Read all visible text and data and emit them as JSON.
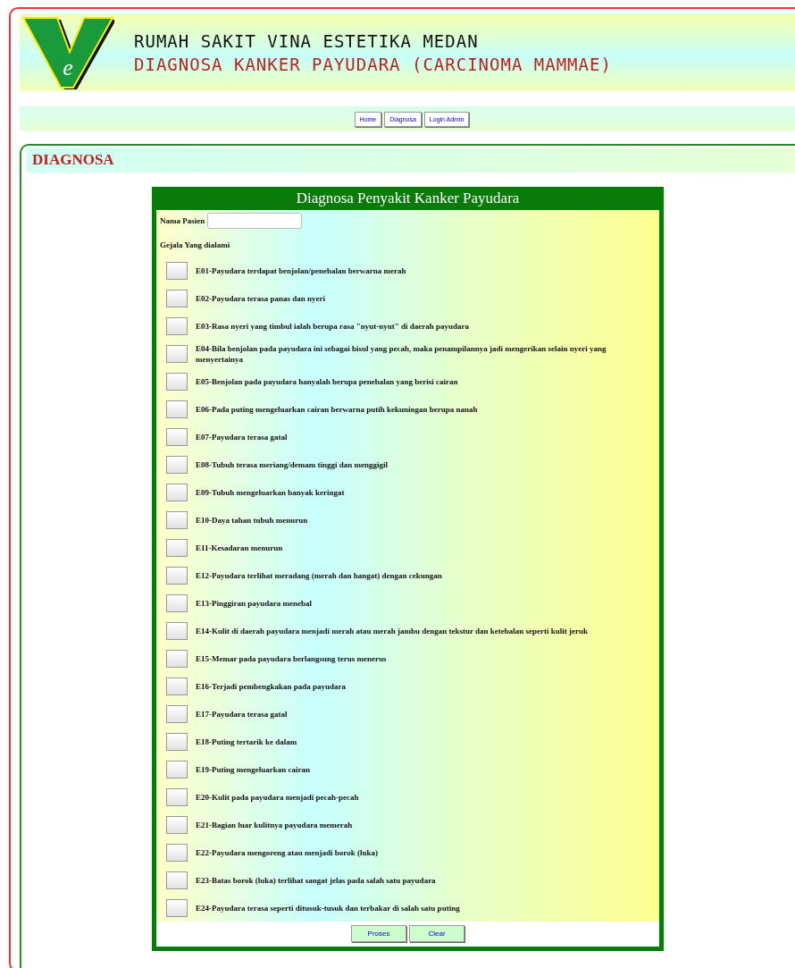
{
  "header": {
    "logo_letter": "e",
    "hospital": "RUMAH SAKIT VINA ESTETIKA MEDAN",
    "subtitle": "DIAGNOSA KANKER PAYUDARA (CARCINOMA MAMMAE)"
  },
  "nav": [
    "Home",
    "Diagnosa",
    "Login Admin"
  ],
  "section": {
    "title": "DIAGNOSA"
  },
  "form": {
    "title": "Diagnosa Penyakit Kanker Payudara",
    "patient_label": "Nama Pasien",
    "symptoms_label": "Gejala Yang dialami",
    "symptoms": [
      {
        "label": "E01-Payudara terdapat benjolan/penebalan berwarna merah",
        "checked": false
      },
      {
        "label": "E02-Payudara terasa panas dan nyeri",
        "checked": false
      },
      {
        "label": "E03-Rasa nyeri yang timbul ialah berupa rasa \"nyut-nyut\" di daerah payudara",
        "checked": false
      },
      {
        "label": "E04-Bila benjolan pada payudara ini sebagai bisul yang pecah, maka penampilannya jadi mengerikan selain nyeri yang menyertainya",
        "checked": false
      },
      {
        "label": "E05-Benjolan pada payudara hanyalah berupa penebalan yang berisi cairan",
        "checked": false
      },
      {
        "label": "E06-Pada puting mengeluarkan cairan berwarna putih kekuningan berupa nanah",
        "checked": false
      },
      {
        "label": "E07-Payudara terasa gatal",
        "checked": false
      },
      {
        "label": "E08-Tubuh terasa meriang/demam tinggi dan menggigil",
        "checked": false
      },
      {
        "label": "E09-Tubuh mengeluarkan banyak keringat",
        "checked": false
      },
      {
        "label": "E10-Daya tahan tubuh menurun",
        "checked": false
      },
      {
        "label": "E11-Kesadaran menurun",
        "checked": false
      },
      {
        "label": "E12-Payudara terlihat meradang (merah dan hangat) dengan cekungan",
        "checked": false
      },
      {
        "label": "E13-Pinggiran payudara menebal",
        "checked": false
      },
      {
        "label": "E14-Kulit di daerah payudara menjadi merah atau merah jambu dengan tekstur dan ketebalan seperti kulit jeruk",
        "checked": false
      },
      {
        "label": "E15-Memar pada payudara berlangsung terus menerus",
        "checked": false
      },
      {
        "label": "E16-Terjadi pembengkakan pada payudara",
        "checked": false
      },
      {
        "label": "E17-Payudara terasa gatal",
        "checked": false
      },
      {
        "label": "E18-Puting tertarik ke dalam",
        "checked": false
      },
      {
        "label": "E19-Puting mengeluarkan cairan",
        "checked": false
      },
      {
        "label": "E20-Kulit pada payudara menjadi pecah-pecah",
        "checked": false
      },
      {
        "label": "E21-Bagian luar kulitnya payudara memerah",
        "checked": false
      },
      {
        "label": "E22-Payudara mengoreng atau menjadi borok (luka)",
        "checked": false
      },
      {
        "label": "E23-Batas borok (luka) terlihat sangat jelas pada salah satu payudara",
        "checked": false
      },
      {
        "label": "E24-Payudara terasa seperti ditusuk-tusuk dan terbakar di salah satu puting",
        "checked": false
      }
    ],
    "buttons": [
      "Proses",
      "Clear"
    ]
  }
}
